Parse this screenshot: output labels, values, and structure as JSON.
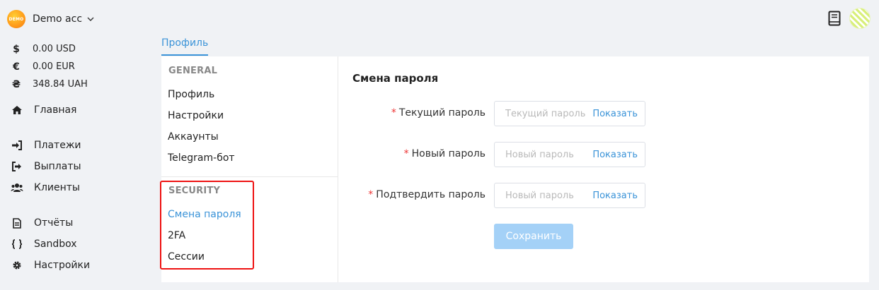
{
  "account": {
    "logo_text": "DEMO",
    "name": "Demo acc",
    "logo_color": "#ff9a1a"
  },
  "balances": [
    {
      "symbol": "$",
      "value": "0.00 USD"
    },
    {
      "symbol": "€",
      "value": "0.00 EUR"
    },
    {
      "symbol": "₴",
      "value": "348.84 UAH"
    }
  ],
  "nav": {
    "home": "Главная",
    "payments": "Платежи",
    "payouts": "Выплаты",
    "clients": "Клиенты",
    "reports": "Отчёты",
    "sandbox": "Sandbox",
    "settings": "Настройки"
  },
  "tabs": {
    "profile": "Профиль"
  },
  "subnav": {
    "general_title": "GENERAL",
    "general_items": [
      "Профиль",
      "Настройки",
      "Аккаунты",
      "Telegram-бот"
    ],
    "security_title": "SECURITY",
    "security_items": [
      "Смена пароля",
      "2FA",
      "Сессии"
    ]
  },
  "form": {
    "title": "Смена пароля",
    "required_mark": "*",
    "current_label": "Текущий пароль",
    "current_placeholder": "Текущий пароль",
    "new_label": "Новый пароль",
    "new_placeholder": "Новый пароль",
    "confirm_label": "Подтвердить пароль",
    "confirm_placeholder": "Новый пароль",
    "show_label": "Показать",
    "save_label": "Сохранить"
  },
  "colors": {
    "accent": "#3a93d8",
    "highlight": "#e11111",
    "required": "#e33333",
    "button_disabled": "#a4d1f7"
  }
}
